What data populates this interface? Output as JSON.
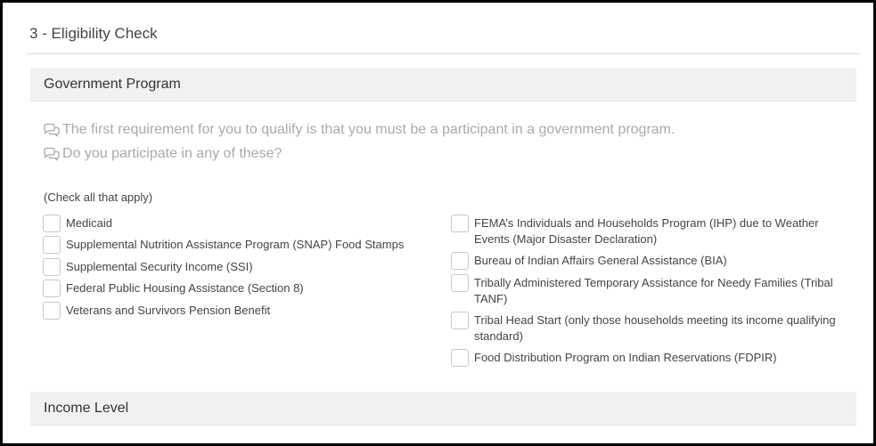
{
  "step": {
    "title": "3 - Eligibility Check"
  },
  "government_program": {
    "header": "Government Program",
    "hints": [
      "The first requirement for you to qualify is that you must be a participant in a government program.",
      "Do you participate in any of these?"
    ],
    "hint_icon": "chat-bubbles-icon",
    "check_note": "(Check all that apply)",
    "left_options": [
      {
        "label": "Medicaid",
        "checked": false
      },
      {
        "label": "Supplemental Nutrition Assistance Program (SNAP) Food Stamps",
        "checked": false
      },
      {
        "label": "Supplemental Security Income (SSI)",
        "checked": false
      },
      {
        "label": "Federal Public Housing Assistance (Section 8)",
        "checked": false
      },
      {
        "label": "Veterans and Survivors Pension Benefit",
        "checked": false
      }
    ],
    "right_options": [
      {
        "label": "FEMA’s Individuals and Households Program (IHP) due to Weather Events (Major Disaster Declaration)",
        "checked": false
      },
      {
        "label": "Bureau of Indian Affairs General Assistance (BIA)",
        "checked": false
      },
      {
        "label": "Tribally Administered Temporary Assistance for Needy Families (Tribal TANF)",
        "checked": false
      },
      {
        "label": "Tribal Head Start (only those households meeting its income qualifying standard)",
        "checked": false
      },
      {
        "label": "Food Distribution Program on Indian Reservations (FDPIR)",
        "checked": false
      }
    ]
  },
  "income_level": {
    "header": "Income Level"
  },
  "colors": {
    "frame_border": "#000000",
    "section_bg": "#f1f1f1",
    "hint_text": "#aaaaaa",
    "checkbox_border": "#c8c8c8"
  }
}
